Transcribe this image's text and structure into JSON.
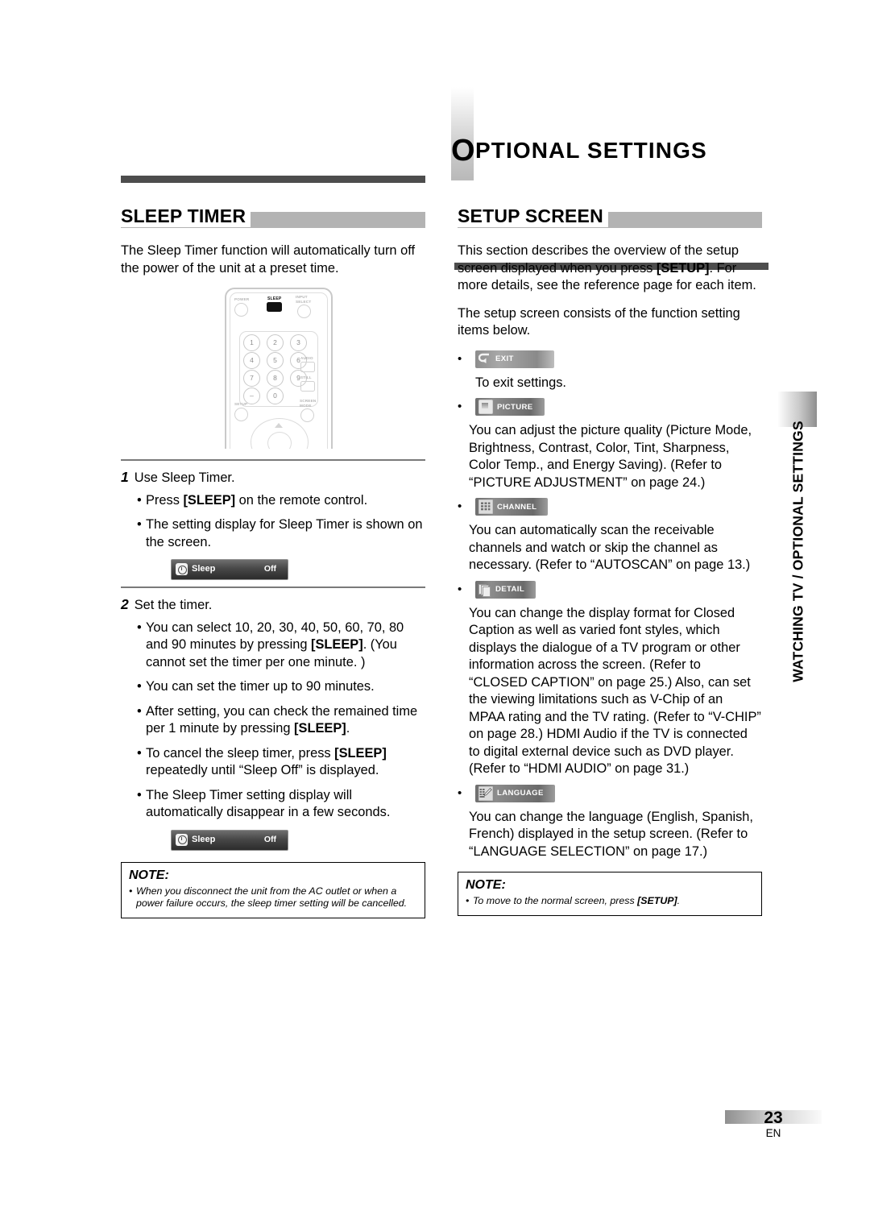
{
  "chapter": {
    "cap": "O",
    "rest": "PTIONAL SETTINGS"
  },
  "left": {
    "section_title": "SLEEP TIMER",
    "intro": "The Sleep Timer function will automatically turn off the power of the unit at a preset time.",
    "remote": {
      "power": "POWER",
      "sleep": "SLEEP",
      "input_select_1": "INPUT",
      "input_select_2": "SELECT",
      "audio": "AUDIO",
      "still": "STILL",
      "setup": "SETUP",
      "screen_1": "SCREEN",
      "screen_2": "MODE",
      "keys": [
        "1",
        "2",
        "3",
        "4",
        "5",
        "6",
        "7",
        "8",
        "9",
        "–",
        "0"
      ]
    },
    "steps": [
      {
        "num": "1",
        "title": "Use Sleep Timer.",
        "bullets": [
          "Press [SLEEP] on the remote control.",
          "The setting display for Sleep Timer is shown on the screen."
        ]
      },
      {
        "num": "2",
        "title": "Set the timer.",
        "bullets": [
          "You can select 10, 20, 30, 40, 50, 60, 70, 80 and 90 minutes by pressing [SLEEP]. (You cannot set the timer per one minute. )",
          "You can set the timer up to 90 minutes.",
          "After setting, you can check the remained time per 1 minute by pressing [SLEEP].",
          "To cancel the sleep timer, press [SLEEP] repeatedly until “Sleep Off” is displayed.",
          "The Sleep Timer setting display will automatically disappear in a few seconds."
        ]
      }
    ],
    "osd": {
      "label": "Sleep",
      "value": "Off",
      "icon": "clock-icon"
    },
    "note": {
      "title": "NOTE:",
      "items": [
        "When you disconnect the unit from the AC outlet or when a power failure occurs, the sleep timer setting will be cancelled."
      ]
    }
  },
  "right": {
    "section_title": "SETUP SCREEN",
    "paragraphs": [
      "This section describes the overview of the setup screen displayed when you press [SETUP]. For more details, see the reference page for each item.",
      "The setup screen consists of the function setting items below."
    ],
    "items": [
      {
        "badge": "EXIT",
        "icon": "return-arrow-icon",
        "style": "exit",
        "text": "To exit settings."
      },
      {
        "badge": "PICTURE",
        "icon": "picture-icon",
        "style": "dark",
        "text": "You can adjust the picture quality (Picture Mode, Brightness, Contrast, Color, Tint, Sharpness, Color Temp., and Energy Saving). (Refer to “PICTURE ADJUSTMENT” on page 24.)"
      },
      {
        "badge": "CHANNEL",
        "icon": "keypad-grid-icon",
        "style": "dark",
        "text": "You can automatically scan the receivable channels and watch or skip the channel as necessary. (Refer to “AUTOSCAN” on page 13.)"
      },
      {
        "badge": "DETAIL",
        "icon": "stacked-pages-icon",
        "style": "dark",
        "text": "You can change the display format for Closed Caption as well as varied font styles, which displays the dialogue of a TV program or other information across the screen. (Refer to “CLOSED CAPTION” on page 25.) Also, can set the viewing limitations such as V-Chip of an MPAA rating and the TV rating. (Refer to “V-CHIP” on page 28.) HDMI Audio if the TV is connected to digital external device such as DVD player. (Refer to “HDMI AUDIO” on page 31.)"
      },
      {
        "badge": "LANGUAGE",
        "icon": "grid-pencil-icon",
        "style": "dark",
        "text": "You can change the language (English, Spanish, French) displayed in the setup screen. (Refer to “LANGUAGE SELECTION” on page 17.)"
      }
    ],
    "note": {
      "title": "NOTE:",
      "items": [
        "To move to the normal screen, press [SETUP]."
      ]
    }
  },
  "side_tab": "WATCHING TV / OPTIONAL SETTINGS",
  "footer": {
    "page": "23",
    "lang": "EN"
  }
}
